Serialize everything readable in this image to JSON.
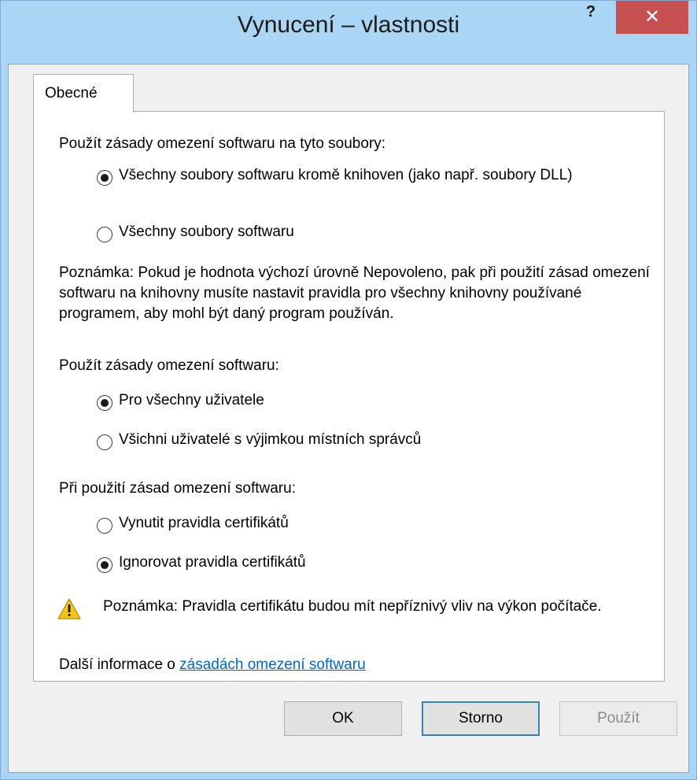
{
  "window": {
    "title": "Vynucení – vlastnosti",
    "help_label": "?",
    "close_label": "✕"
  },
  "tabs": [
    {
      "label": "Obecné",
      "selected": true
    }
  ],
  "group_files": {
    "heading": "Použít zásady omezení softwaru na tyto soubory:",
    "options": [
      {
        "label": "Všechny soubory softwaru kromě knihoven (jako např. soubory DLL)",
        "checked": true
      },
      {
        "label": "Všechny soubory softwaru",
        "checked": false
      }
    ]
  },
  "note_libraries": "Poznámka: Pokud je hodnota výchozí úrovně Nepovoleno, pak při použití zásad omezení softwaru na knihovny musíte nastavit pravidla pro všechny knihovny používané programem, aby mohl být daný program používán.",
  "group_users": {
    "heading": "Použít zásady omezení softwaru:",
    "options": [
      {
        "label": "Pro všechny uživatele",
        "checked": true
      },
      {
        "label": "Všichni uživatelé s výjimkou místních správců",
        "checked": false
      }
    ]
  },
  "group_certs": {
    "heading": "Při použití zásad omezení softwaru:",
    "options": [
      {
        "label": "Vynutit pravidla certifikátů",
        "checked": false
      },
      {
        "label": "Ignorovat pravidla certifikátů",
        "checked": true
      }
    ]
  },
  "warning": {
    "icon": "warning-icon",
    "text": "Poznámka: Pravidla certifikátu budou mít nepříznivý vliv na výkon počítače."
  },
  "more_info": {
    "prefix": "Další informace o ",
    "link": "zásadách omezení softwaru"
  },
  "buttons": {
    "ok": "OK",
    "cancel": "Storno",
    "apply": "Použít"
  },
  "colors": {
    "frame": "#abd5f4",
    "close": "#c75050",
    "link": "#0066cc"
  }
}
